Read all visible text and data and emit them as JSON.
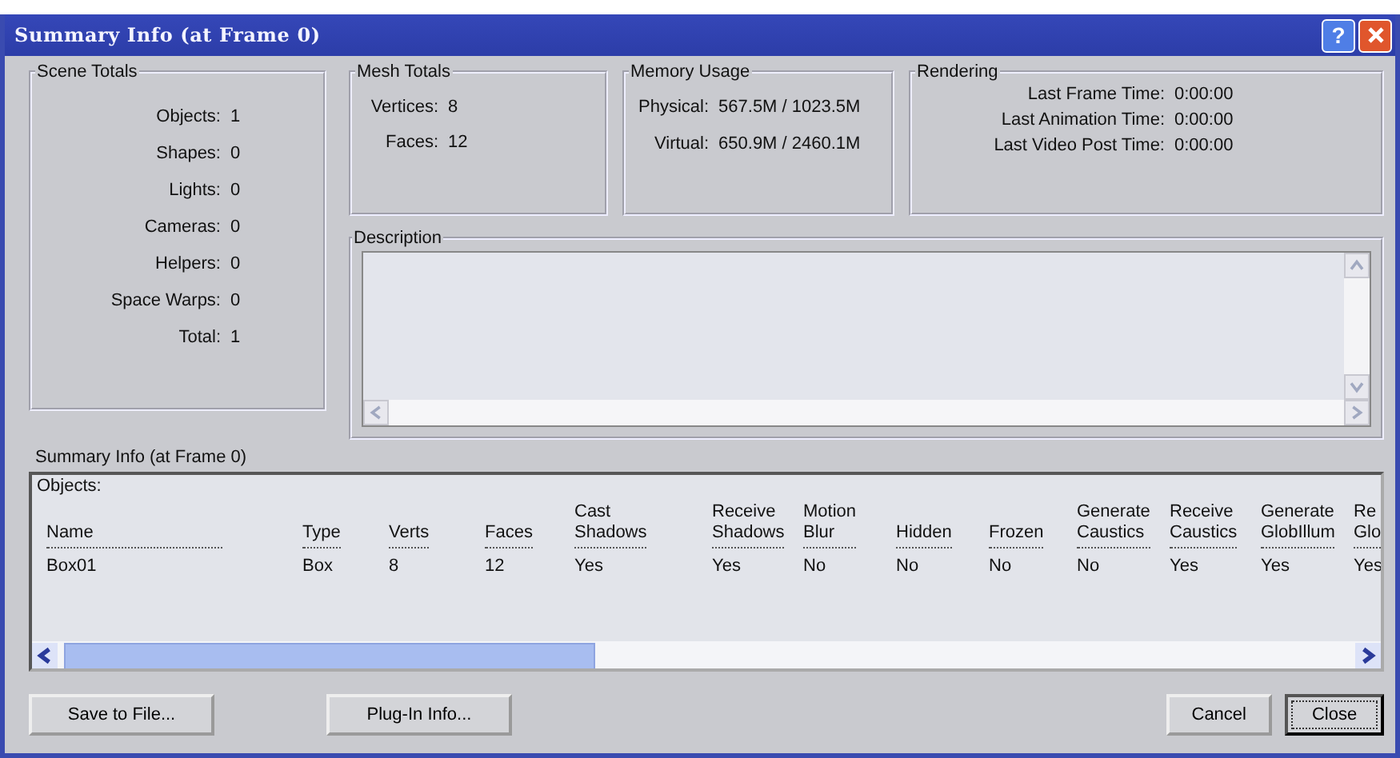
{
  "window": {
    "title": "Summary Info (at Frame 0)"
  },
  "title_buttons": [
    {
      "kind": "help",
      "label": "?"
    },
    {
      "kind": "close"
    }
  ],
  "scene_totals": {
    "title": "Scene Totals",
    "rows": [
      {
        "label": "Objects:",
        "value": "1"
      },
      {
        "label": "Shapes:",
        "value": "0"
      },
      {
        "label": "Lights:",
        "value": "0"
      },
      {
        "label": "Cameras:",
        "value": "0"
      },
      {
        "label": "Helpers:",
        "value": "0"
      },
      {
        "label": "Space Warps:",
        "value": "0"
      },
      {
        "label": "Total:",
        "value": "1"
      }
    ]
  },
  "mesh_totals": {
    "title": "Mesh Totals",
    "rows": [
      {
        "label": "Vertices:",
        "value": "8"
      },
      {
        "label": "Faces:",
        "value": "12"
      }
    ]
  },
  "memory_usage": {
    "title": "Memory Usage",
    "rows": [
      {
        "label": "Physical:",
        "value": "567.5M / 1023.5M"
      },
      {
        "label": "Virtual:",
        "value": "650.9M / 2460.1M"
      }
    ]
  },
  "rendering": {
    "title": "Rendering",
    "rows": [
      {
        "label": "Last Frame Time:",
        "value": "0:00:00"
      },
      {
        "label": "Last Animation Time:",
        "value": "0:00:00"
      },
      {
        "label": "Last Video Post Time:",
        "value": "0:00:00"
      }
    ]
  },
  "description": {
    "title": "Description"
  },
  "summary_label": "Summary Info (at Frame 0)",
  "objects": {
    "title": "Objects:",
    "columns": [
      {
        "lines": [
          "Name"
        ]
      },
      {
        "lines": [
          "Type"
        ]
      },
      {
        "lines": [
          "Verts"
        ]
      },
      {
        "lines": [
          "Faces"
        ]
      },
      {
        "lines": [
          "Cast",
          "Shadows"
        ]
      },
      {
        "lines": [
          "Receive",
          "Shadows"
        ]
      },
      {
        "lines": [
          "Motion",
          "Blur"
        ]
      },
      {
        "lines": [
          "Hidden"
        ]
      },
      {
        "lines": [
          "Frozen"
        ]
      },
      {
        "lines": [
          "Generate",
          "Caustics"
        ]
      },
      {
        "lines": [
          "Receive",
          "Caustics"
        ]
      },
      {
        "lines": [
          "Generate",
          "GlobIllum"
        ]
      },
      {
        "lines": [
          "Re",
          "Glo"
        ]
      }
    ],
    "rows": [
      [
        "Box01",
        "Box",
        "8",
        "12",
        "Yes",
        "Yes",
        "No",
        "No",
        "No",
        "No",
        "Yes",
        "Yes",
        "Yes"
      ]
    ]
  },
  "buttons": [
    {
      "label": "Save to File...",
      "default": false,
      "kind": "left"
    },
    {
      "label": "Plug-In Info...",
      "default": false,
      "kind": "left"
    },
    {
      "label": "Cancel",
      "default": false,
      "kind": "right"
    },
    {
      "label": "Close",
      "default": true,
      "kind": "right"
    }
  ]
}
